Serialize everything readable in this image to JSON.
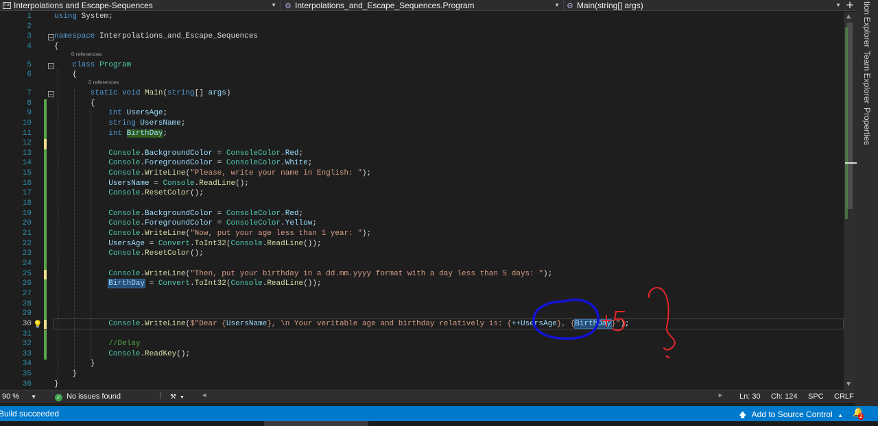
{
  "navbar": {
    "project_icon": "csharp-project-icon",
    "project": "Interpolations and Escape-Sequences",
    "type": "Interpolations_and_Escape_Sequences.Program",
    "member_icon": "method-icon",
    "member": "Main(string[] args)",
    "split_icon": "plus-icon"
  },
  "right_panel": {
    "tabs": [
      "tion Explorer",
      "Team Explorer",
      "Properties"
    ]
  },
  "editor": {
    "current_line": 30,
    "codelens": "0 references",
    "lines": [
      [
        {
          "t": "using ",
          "c": "kw"
        },
        {
          "t": "System;"
        }
      ],
      [],
      [
        {
          "t": "namespace ",
          "c": "kw"
        },
        {
          "t": "Interpolations_and_Escape_Sequences"
        }
      ],
      [
        {
          "t": "{"
        }
      ],
      [
        {
          "t": "    class ",
          "c": "kw"
        },
        {
          "t": "Program",
          "c": "ty"
        }
      ],
      [
        {
          "t": "    {"
        }
      ],
      [
        {
          "t": "        static void ",
          "c": "kw"
        },
        {
          "t": "Main",
          "c": "fn"
        },
        {
          "t": "("
        },
        {
          "t": "string",
          "c": "kw"
        },
        {
          "t": "[] "
        },
        {
          "t": "args",
          "c": "pa"
        },
        {
          "t": ")"
        }
      ],
      [
        {
          "t": "        {"
        }
      ],
      [
        {
          "t": "            int ",
          "c": "kw"
        },
        {
          "t": "UsersAge",
          "c": "pa"
        },
        {
          "t": ";"
        }
      ],
      [
        {
          "t": "            string ",
          "c": "kw"
        },
        {
          "t": "UsersName",
          "c": "pa"
        },
        {
          "t": ";"
        }
      ],
      [
        {
          "t": "            int ",
          "c": "kw"
        },
        {
          "t": "BirthDay",
          "c": "pa",
          "h": "hl-green"
        },
        {
          "t": ";"
        }
      ],
      [],
      [
        {
          "t": "            "
        },
        {
          "t": "Console",
          "c": "ty"
        },
        {
          "t": "."
        },
        {
          "t": "BackgroundColor",
          "c": "pa"
        },
        {
          "t": " = "
        },
        {
          "t": "ConsoleColor",
          "c": "ty"
        },
        {
          "t": "."
        },
        {
          "t": "Red",
          "c": "pa"
        },
        {
          "t": ";"
        }
      ],
      [
        {
          "t": "            "
        },
        {
          "t": "Console",
          "c": "ty"
        },
        {
          "t": "."
        },
        {
          "t": "ForegroundColor",
          "c": "pa"
        },
        {
          "t": " = "
        },
        {
          "t": "ConsoleColor",
          "c": "ty"
        },
        {
          "t": "."
        },
        {
          "t": "White",
          "c": "pa"
        },
        {
          "t": ";"
        }
      ],
      [
        {
          "t": "            "
        },
        {
          "t": "Console",
          "c": "ty"
        },
        {
          "t": "."
        },
        {
          "t": "WriteLine",
          "c": "fn"
        },
        {
          "t": "("
        },
        {
          "t": "\"Please, write your name in English: \"",
          "c": "st"
        },
        {
          "t": ");"
        }
      ],
      [
        {
          "t": "            "
        },
        {
          "t": "UsersName",
          "c": "pa"
        },
        {
          "t": " = "
        },
        {
          "t": "Console",
          "c": "ty"
        },
        {
          "t": "."
        },
        {
          "t": "ReadLine",
          "c": "fn"
        },
        {
          "t": "();"
        }
      ],
      [
        {
          "t": "            "
        },
        {
          "t": "Console",
          "c": "ty"
        },
        {
          "t": "."
        },
        {
          "t": "ResetColor",
          "c": "fn"
        },
        {
          "t": "();"
        }
      ],
      [],
      [
        {
          "t": "            "
        },
        {
          "t": "Console",
          "c": "ty"
        },
        {
          "t": "."
        },
        {
          "t": "BackgroundColor",
          "c": "pa"
        },
        {
          "t": " = "
        },
        {
          "t": "ConsoleColor",
          "c": "ty"
        },
        {
          "t": "."
        },
        {
          "t": "Red",
          "c": "pa"
        },
        {
          "t": ";"
        }
      ],
      [
        {
          "t": "            "
        },
        {
          "t": "Console",
          "c": "ty"
        },
        {
          "t": "."
        },
        {
          "t": "ForegroundColor",
          "c": "pa"
        },
        {
          "t": " = "
        },
        {
          "t": "ConsoleColor",
          "c": "ty"
        },
        {
          "t": "."
        },
        {
          "t": "Yellow",
          "c": "pa"
        },
        {
          "t": ";"
        }
      ],
      [
        {
          "t": "            "
        },
        {
          "t": "Console",
          "c": "ty"
        },
        {
          "t": "."
        },
        {
          "t": "WriteLine",
          "c": "fn"
        },
        {
          "t": "("
        },
        {
          "t": "\"Now, put your age less than 1 year: \"",
          "c": "st"
        },
        {
          "t": ");"
        }
      ],
      [
        {
          "t": "            "
        },
        {
          "t": "UsersAge",
          "c": "pa"
        },
        {
          "t": " = "
        },
        {
          "t": "Convert",
          "c": "ty"
        },
        {
          "t": "."
        },
        {
          "t": "ToInt32",
          "c": "fn"
        },
        {
          "t": "("
        },
        {
          "t": "Console",
          "c": "ty"
        },
        {
          "t": "."
        },
        {
          "t": "ReadLine",
          "c": "fn"
        },
        {
          "t": "());"
        }
      ],
      [
        {
          "t": "            "
        },
        {
          "t": "Console",
          "c": "ty"
        },
        {
          "t": "."
        },
        {
          "t": "ResetColor",
          "c": "fn"
        },
        {
          "t": "();"
        }
      ],
      [],
      [
        {
          "t": "            "
        },
        {
          "t": "Console",
          "c": "ty"
        },
        {
          "t": "."
        },
        {
          "t": "WriteLine",
          "c": "fn"
        },
        {
          "t": "("
        },
        {
          "t": "\"Then, put your birthday in a dd.mm.yyyy format with a day less than 5 days: \"",
          "c": "st"
        },
        {
          "t": ");"
        }
      ],
      [
        {
          "t": "            "
        },
        {
          "t": "BirthDay",
          "c": "pa",
          "h": "hl-blue"
        },
        {
          "t": " = "
        },
        {
          "t": "Convert",
          "c": "ty"
        },
        {
          "t": "."
        },
        {
          "t": "ToInt32",
          "c": "fn"
        },
        {
          "t": "("
        },
        {
          "t": "Console",
          "c": "ty"
        },
        {
          "t": "."
        },
        {
          "t": "ReadLine",
          "c": "fn"
        },
        {
          "t": "());"
        }
      ],
      [],
      [],
      [],
      [
        {
          "t": "            "
        },
        {
          "t": "Console",
          "c": "ty"
        },
        {
          "t": "."
        },
        {
          "t": "WriteLine",
          "c": "fn"
        },
        {
          "t": "("
        },
        {
          "t": "$\"Dear {",
          "c": "st"
        },
        {
          "t": "UsersName",
          "c": "pa"
        },
        {
          "t": "}, ",
          "c": "st"
        },
        {
          "t": "\\n",
          "c": "st"
        },
        {
          "t": " Your veritable age and birthday relatively is: {",
          "c": "st"
        },
        {
          "t": "++UsersAge",
          "c": "pa"
        },
        {
          "t": "}, {",
          "c": "st"
        },
        {
          "t": "BirthDay",
          "c": "pa",
          "h": "hl-blue"
        },
        {
          "t": "}\"",
          "c": "st"
        },
        {
          "t": ");"
        }
      ],
      [],
      [
        {
          "t": "            //Delay",
          "c": "cm"
        }
      ],
      [
        {
          "t": "            "
        },
        {
          "t": "Console",
          "c": "ty"
        },
        {
          "t": "."
        },
        {
          "t": "ReadKey",
          "c": "fn"
        },
        {
          "t": "();"
        }
      ],
      [
        {
          "t": "        }"
        }
      ],
      [
        {
          "t": "    }"
        }
      ],
      [
        {
          "t": "}"
        }
      ]
    ]
  },
  "annotations": {
    "plus_five": "+5",
    "question": "?",
    "circle_color": "#1212d6",
    "ink_color": "#e8252a"
  },
  "editor_status": {
    "zoom": "90 %",
    "issues": "No issues found",
    "issues_icon": "check-circle-icon",
    "brush_icon": "cleanup-icon",
    "line": "Ln: 30",
    "col": "Ch: 124",
    "spc": "SPC",
    "crlf": "CRLF"
  },
  "statusbar": {
    "build": "Build succeeded",
    "source_control": "Add to Source Control",
    "notification_count": "2",
    "color": "#007acc"
  }
}
